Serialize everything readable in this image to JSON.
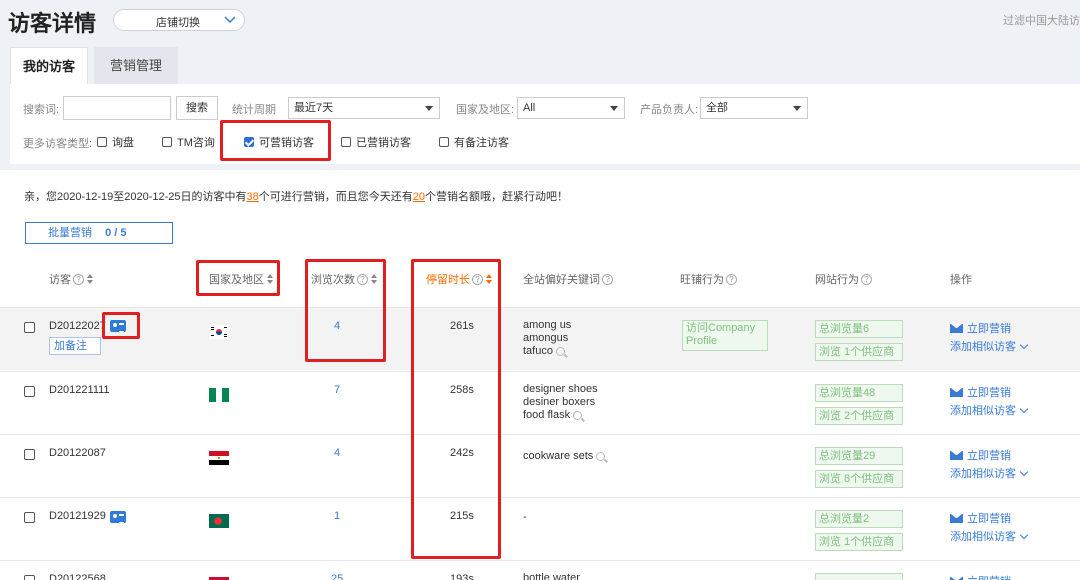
{
  "header": {
    "title": "访客详情",
    "store_switch": "店铺切换",
    "filter_note": "过滤中国大陆访"
  },
  "tabs": [
    {
      "label": "我的访客",
      "active": true
    },
    {
      "label": "营销管理",
      "active": false
    }
  ],
  "filters": {
    "search_label": "搜索词:",
    "search_value": "",
    "search_button": "搜索",
    "period_label": "统计周期",
    "period_value": "最近7天",
    "country_label": "国家及地区:",
    "country_value": "All",
    "product_owner_label": "产品负责人:",
    "product_owner_value": "全部",
    "more_types_label": "更多访客类型:",
    "types": [
      {
        "label": "询盘",
        "checked": false
      },
      {
        "label": "TM咨询",
        "checked": false
      },
      {
        "label": "可营销访客",
        "checked": true
      },
      {
        "label": "已营销访客",
        "checked": false
      },
      {
        "label": "有备注访客",
        "checked": false
      }
    ]
  },
  "notice": {
    "prefix": "亲，您2020-12-19至2020-12-25日的访客中有",
    "marketable_count": "38",
    "middle": "个可进行营销，而且您今天还有",
    "remaining_count": "20",
    "suffix": "个营销名额哦，赶紧行动吧！"
  },
  "batch": {
    "label": "批量营销",
    "count": "0 / 5"
  },
  "columns": {
    "visitor": "访客",
    "country": "国家及地区",
    "views": "浏览次数",
    "dwell": "停留时长",
    "keywords": "全站偏好关键词",
    "wangwang": "旺铺行为",
    "site": "网站行为",
    "action": "操作"
  },
  "rows": [
    {
      "id": "D20122027",
      "has_card": true,
      "add_note": "加备注",
      "flag": "kr",
      "views": "4",
      "dwell": "261s",
      "keywords": [
        "among us",
        "amongus",
        "tafuco"
      ],
      "wangwang": "访问Company Profile",
      "site_total": "总浏览量6",
      "site_suppliers": "浏览 1个供应商"
    },
    {
      "id": "D201221111",
      "has_card": false,
      "flag": "ng",
      "views": "7",
      "dwell": "258s",
      "keywords": [
        "designer shoes",
        "desiner boxers",
        "food flask"
      ],
      "site_total": "总浏览量48",
      "site_suppliers": "浏览 2个供应商"
    },
    {
      "id": "D20122087",
      "has_card": false,
      "flag": "eg",
      "views": "4",
      "dwell": "242s",
      "keywords": [
        "cookware sets"
      ],
      "site_total": "总浏览量29",
      "site_suppliers": "浏览 8个供应商"
    },
    {
      "id": "D20121929",
      "has_card": true,
      "flag": "bd",
      "views": "1",
      "dwell": "215s",
      "keywords": [
        "-"
      ],
      "site_total": "总浏览量2",
      "site_suppliers": "浏览 1个供应商"
    }
  ],
  "row_actions": {
    "market_now": "立即营销",
    "add_similar": "添加相似访客"
  },
  "partial_row": {
    "id": "D20122568",
    "views": "25",
    "dwell": "193s",
    "keyword": "bottle water"
  }
}
